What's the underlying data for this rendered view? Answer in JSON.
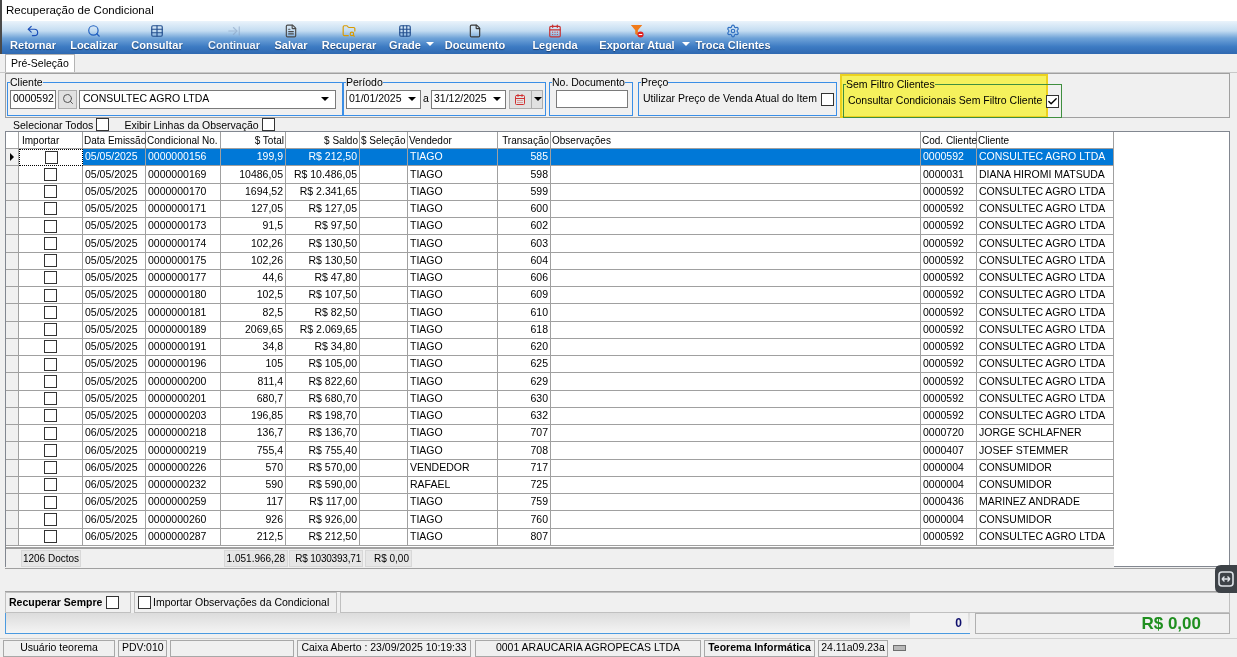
{
  "window": {
    "title": "Recuperação de Condicional"
  },
  "toolbar": [
    {
      "label": "Retornar",
      "disabled": false,
      "dropdown": false
    },
    {
      "label": "Localizar",
      "disabled": false,
      "dropdown": false
    },
    {
      "label": "Consultar",
      "disabled": false,
      "dropdown": false
    },
    {
      "label": "Continuar",
      "disabled": true,
      "dropdown": false
    },
    {
      "label": "Salvar",
      "disabled": false,
      "dropdown": false
    },
    {
      "label": "Recuperar",
      "disabled": false,
      "dropdown": false
    },
    {
      "label": "Grade",
      "disabled": false,
      "dropdown": true
    },
    {
      "label": "Documento",
      "disabled": false,
      "dropdown": false
    },
    {
      "label": "Legenda",
      "disabled": false,
      "dropdown": false
    },
    {
      "label": "Exportar Atual",
      "disabled": false,
      "dropdown": true
    },
    {
      "label": "Troca Clientes",
      "disabled": false,
      "dropdown": false
    }
  ],
  "tabs": [
    {
      "label": "Pré-Seleção",
      "selected": true
    }
  ],
  "filters": {
    "cliente": {
      "legend": "Cliente",
      "code": "0000592",
      "name": "CONSULTEC AGRO LTDA"
    },
    "periodo": {
      "legend": "Período",
      "from": "01/01/2025",
      "separator": "a",
      "to": "31/12/2025"
    },
    "documento": {
      "legend": "No. Documento"
    },
    "preco": {
      "legend": "Preço",
      "label": "Utilizar Preço de Venda Atual do Item",
      "checked": false
    },
    "sem_filtro": {
      "legend": "Sem Filtro Clientes",
      "label": "Consultar Condicionais Sem Filtro Cliente",
      "checked": true,
      "highlighted": true
    }
  },
  "options": [
    {
      "label": "Selecionar Todos",
      "checked": false
    },
    {
      "label": "Exibir Linhas da Observação",
      "checked": false
    }
  ],
  "table": {
    "columns": [
      "Importar",
      "Data Emissão",
      "Condicional No.",
      "$ Total",
      "$ Saldo",
      "$ Seleção",
      "Vendedor",
      "Transação",
      "Observações",
      "Cod. Cliente",
      "Cliente"
    ],
    "rows": [
      {
        "selected": true,
        "import_checked": false,
        "date": "05/05/2025",
        "number": "0000000156",
        "total": "199,9",
        "saldo": "R$ 212,50",
        "seller": "TIAGO",
        "transaction": "585",
        "client_code": "0000592",
        "client": "CONSULTEC AGRO LTDA"
      },
      {
        "selected": false,
        "import_checked": false,
        "date": "05/05/2025",
        "number": "0000000169",
        "total": "10486,05",
        "saldo": "R$ 10.486,05",
        "seller": "TIAGO",
        "transaction": "598",
        "client_code": "0000031",
        "client": "DIANA HIROMI MATSUDA"
      },
      {
        "selected": false,
        "import_checked": false,
        "date": "05/05/2025",
        "number": "0000000170",
        "total": "1694,52",
        "saldo": "R$ 2.341,65",
        "seller": "TIAGO",
        "transaction": "599",
        "client_code": "0000592",
        "client": "CONSULTEC AGRO LTDA"
      },
      {
        "selected": false,
        "import_checked": false,
        "date": "05/05/2025",
        "number": "0000000171",
        "total": "127,05",
        "saldo": "R$ 127,05",
        "seller": "TIAGO",
        "transaction": "600",
        "client_code": "0000592",
        "client": "CONSULTEC AGRO LTDA"
      },
      {
        "selected": false,
        "import_checked": false,
        "date": "05/05/2025",
        "number": "0000000173",
        "total": "91,5",
        "saldo": "R$ 97,50",
        "seller": "TIAGO",
        "transaction": "602",
        "client_code": "0000592",
        "client": "CONSULTEC AGRO LTDA"
      },
      {
        "selected": false,
        "import_checked": false,
        "date": "05/05/2025",
        "number": "0000000174",
        "total": "102,26",
        "saldo": "R$ 130,50",
        "seller": "TIAGO",
        "transaction": "603",
        "client_code": "0000592",
        "client": "CONSULTEC AGRO LTDA"
      },
      {
        "selected": false,
        "import_checked": false,
        "date": "05/05/2025",
        "number": "0000000175",
        "total": "102,26",
        "saldo": "R$ 130,50",
        "seller": "TIAGO",
        "transaction": "604",
        "client_code": "0000592",
        "client": "CONSULTEC AGRO LTDA"
      },
      {
        "selected": false,
        "import_checked": false,
        "date": "05/05/2025",
        "number": "0000000177",
        "total": "44,6",
        "saldo": "R$ 47,80",
        "seller": "TIAGO",
        "transaction": "606",
        "client_code": "0000592",
        "client": "CONSULTEC AGRO LTDA"
      },
      {
        "selected": false,
        "import_checked": false,
        "date": "05/05/2025",
        "number": "0000000180",
        "total": "102,5",
        "saldo": "R$ 107,50",
        "seller": "TIAGO",
        "transaction": "609",
        "client_code": "0000592",
        "client": "CONSULTEC AGRO LTDA"
      },
      {
        "selected": false,
        "import_checked": false,
        "date": "05/05/2025",
        "number": "0000000181",
        "total": "82,5",
        "saldo": "R$ 82,50",
        "seller": "TIAGO",
        "transaction": "610",
        "client_code": "0000592",
        "client": "CONSULTEC AGRO LTDA"
      },
      {
        "selected": false,
        "import_checked": false,
        "date": "05/05/2025",
        "number": "0000000189",
        "total": "2069,65",
        "saldo": "R$ 2.069,65",
        "seller": "TIAGO",
        "transaction": "618",
        "client_code": "0000592",
        "client": "CONSULTEC AGRO LTDA"
      },
      {
        "selected": false,
        "import_checked": false,
        "date": "05/05/2025",
        "number": "0000000191",
        "total": "34,8",
        "saldo": "R$ 34,80",
        "seller": "TIAGO",
        "transaction": "620",
        "client_code": "0000592",
        "client": "CONSULTEC AGRO LTDA"
      },
      {
        "selected": false,
        "import_checked": false,
        "date": "05/05/2025",
        "number": "0000000196",
        "total": "105",
        "saldo": "R$ 105,00",
        "seller": "TIAGO",
        "transaction": "625",
        "client_code": "0000592",
        "client": "CONSULTEC AGRO LTDA"
      },
      {
        "selected": false,
        "import_checked": false,
        "date": "05/05/2025",
        "number": "0000000200",
        "total": "811,4",
        "saldo": "R$ 822,60",
        "seller": "TIAGO",
        "transaction": "629",
        "client_code": "0000592",
        "client": "CONSULTEC AGRO LTDA"
      },
      {
        "selected": false,
        "import_checked": false,
        "date": "05/05/2025",
        "number": "0000000201",
        "total": "680,7",
        "saldo": "R$ 680,70",
        "seller": "TIAGO",
        "transaction": "630",
        "client_code": "0000592",
        "client": "CONSULTEC AGRO LTDA"
      },
      {
        "selected": false,
        "import_checked": false,
        "date": "05/05/2025",
        "number": "0000000203",
        "total": "196,85",
        "saldo": "R$ 198,70",
        "seller": "TIAGO",
        "transaction": "632",
        "client_code": "0000592",
        "client": "CONSULTEC AGRO LTDA"
      },
      {
        "selected": false,
        "import_checked": false,
        "date": "06/05/2025",
        "number": "0000000218",
        "total": "136,7",
        "saldo": "R$ 136,70",
        "seller": "TIAGO",
        "transaction": "707",
        "client_code": "0000720",
        "client": "JORGE SCHLAFNER"
      },
      {
        "selected": false,
        "import_checked": false,
        "date": "06/05/2025",
        "number": "0000000219",
        "total": "755,4",
        "saldo": "R$ 755,40",
        "seller": "TIAGO",
        "transaction": "708",
        "client_code": "0000407",
        "client": "JOSEF STEMMER"
      },
      {
        "selected": false,
        "import_checked": false,
        "date": "06/05/2025",
        "number": "0000000226",
        "total": "570",
        "saldo": "R$ 570,00",
        "seller": "VENDEDOR",
        "transaction": "717",
        "client_code": "0000004",
        "client": "CONSUMIDOR"
      },
      {
        "selected": false,
        "import_checked": false,
        "date": "06/05/2025",
        "number": "0000000232",
        "total": "590",
        "saldo": "R$ 590,00",
        "seller": "RAFAEL",
        "transaction": "725",
        "client_code": "0000004",
        "client": "CONSUMIDOR"
      },
      {
        "selected": false,
        "import_checked": false,
        "date": "06/05/2025",
        "number": "0000000259",
        "total": "117",
        "saldo": "R$ 117,00",
        "seller": "TIAGO",
        "transaction": "759",
        "client_code": "0000436",
        "client": "MARINEZ ANDRADE"
      },
      {
        "selected": false,
        "import_checked": false,
        "date": "06/05/2025",
        "number": "0000000260",
        "total": "926",
        "saldo": "R$ 926,00",
        "seller": "TIAGO",
        "transaction": "760",
        "client_code": "0000004",
        "client": "CONSUMIDOR"
      },
      {
        "selected": false,
        "import_checked": false,
        "date": "06/05/2025",
        "number": "0000000287",
        "total": "212,5",
        "saldo": "R$ 212,50",
        "seller": "TIAGO",
        "transaction": "807",
        "client_code": "0000592",
        "client": "CONSULTEC AGRO LTDA"
      }
    ],
    "totals": {
      "count": "1206 Doctos",
      "total": "1.051.966,28",
      "saldo": "R$ 1030393,71",
      "selecao": "R$ 0,00"
    }
  },
  "bottom_bar": {
    "recuperar_sempre": {
      "label": "Recuperar Sempre",
      "checked": false
    },
    "importar_observacoes": {
      "label": "Importar Observações da Condicional",
      "checked": false
    }
  },
  "summary": {
    "count": "0",
    "amount": "R$ 0,00"
  },
  "status_bar": [
    {
      "kind": "text",
      "text": "Usuário teorema"
    },
    {
      "kind": "text",
      "text": "PDV:010"
    },
    {
      "kind": "blank"
    },
    {
      "kind": "text",
      "text": "Caixa Aberto : 23/09/2025 10:19:33"
    },
    {
      "kind": "text",
      "text": "0001 ARAUCARIA AGROPECAS LTDA"
    },
    {
      "kind": "strong",
      "text": "Teorema Informática"
    },
    {
      "kind": "text",
      "text": "24.11a09.23a"
    }
  ]
}
